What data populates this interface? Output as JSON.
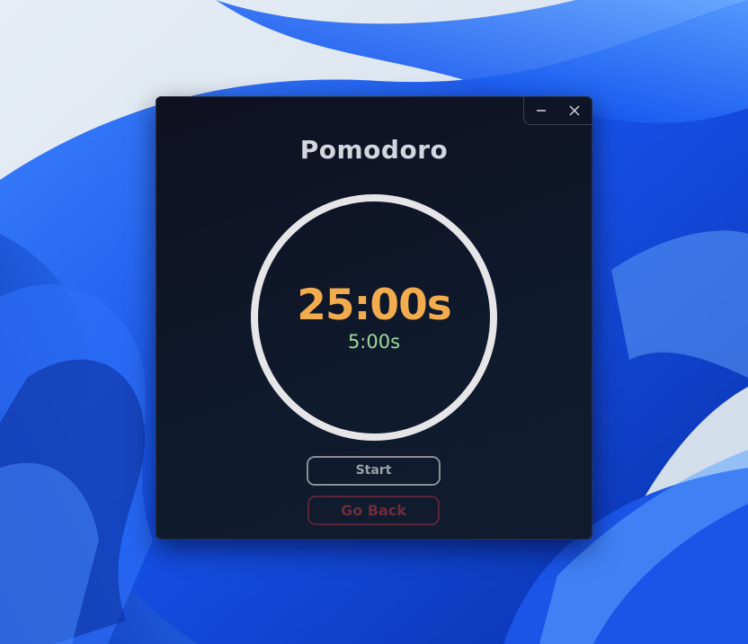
{
  "window": {
    "title": "Pomodoro",
    "controls": {
      "minimize_icon": "minimize-icon",
      "close_icon": "close-icon"
    }
  },
  "timer": {
    "work_time": "25:00s",
    "break_time": "5:00s"
  },
  "actions": {
    "start_label": "Start",
    "back_label": "Go Back"
  },
  "colors": {
    "work_time": "#f2ac4e",
    "break_time": "#9ed99a",
    "ring": "#e6e6e9",
    "back_button": "#6e2d3a",
    "desktop_accent": "#1a5cf0"
  }
}
